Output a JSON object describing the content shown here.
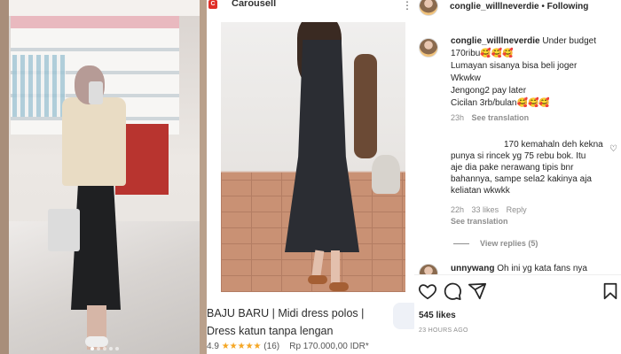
{
  "carousell": {
    "app_name": "Carousell",
    "title_lines": [
      "BAJU BARU | Midi dress polos |",
      "Dress katun tanpa lengan"
    ],
    "rating_value": "4.9",
    "stars": "★★★★★",
    "review_count": "(16)",
    "price": "Rp 170.000,00 IDR*"
  },
  "instagram": {
    "header": {
      "username": "conglie_willlneverdie",
      "separator": "•",
      "follow_status": "Following",
      "more_icon": "more-dots-icon"
    },
    "comments": [
      {
        "username": "conglie_willlneverdie",
        "lines": [
          "Under budget",
          "170ribu🥰🥰🥰",
          "Lumayan sisanya bisa beli joger",
          "Wkwkw",
          "Jengong2 pay later",
          "Cicilan 3rb/bulan🥰🥰🥰"
        ],
        "time": "23h",
        "translate": "See translation"
      },
      {
        "lines": [
          "170 kemahaln deh kekna",
          "punya si rincek yg 75 rebu bok. Itu",
          "aje dia pake nerawang tipis bnr",
          "bahannya, sampe sela2 kakinya aja",
          "keliatan wkwkk"
        ],
        "time": "22h",
        "likes": "33 likes",
        "reply": "Reply",
        "translate": "See translation"
      }
    ],
    "view_replies": "View replies (5)",
    "partial_comment": {
      "username": "unnywang",
      "text": "Oh ini yg kata fans nya"
    },
    "like_count": "545 likes",
    "timestamp": "23 HOURS AGO",
    "icons": [
      "heart-icon",
      "comment-icon",
      "share-icon",
      "bookmark-icon"
    ]
  },
  "colors": {
    "text_primary": "#262626",
    "text_secondary": "#8e8e8e",
    "carousell_red": "#e02f28",
    "star": "#f5a623"
  }
}
